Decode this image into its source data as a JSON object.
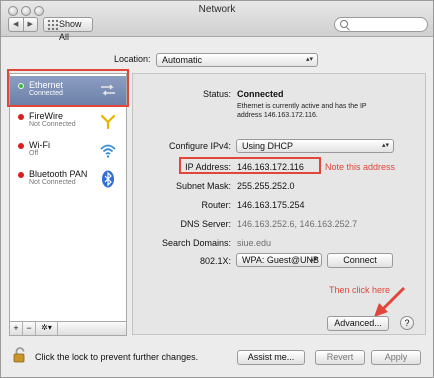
{
  "window": {
    "title": "Network"
  },
  "toolbar": {
    "back": "◀",
    "forward": "▶",
    "show_all": "Show All",
    "search_placeholder": ""
  },
  "location": {
    "label": "Location:",
    "value": "Automatic"
  },
  "services": [
    {
      "name": "Ethernet",
      "status": "Connected",
      "status_color": "#3dbb3d",
      "icon": "ethernet-arrows-icon",
      "selected": true
    },
    {
      "name": "FireWire",
      "status": "Not Connected",
      "status_color": "#d81f1f",
      "icon": "firewire-icon"
    },
    {
      "name": "Wi-Fi",
      "status": "Off",
      "status_color": "#d81f1f",
      "icon": "wifi-icon"
    },
    {
      "name": "Bluetooth PAN",
      "status": "Not Connected",
      "status_color": "#d81f1f",
      "icon": "bluetooth-icon"
    }
  ],
  "sidebar_buttons": {
    "add": "+",
    "remove": "−",
    "action": "✲▾"
  },
  "details": {
    "status_label": "Status:",
    "status_value": "Connected",
    "status_desc": "Ethernet is currently active and has the IP address 146.163.172.116.",
    "configure_label": "Configure IPv4:",
    "configure_value": "Using DHCP",
    "ip_label": "IP Address:",
    "ip_value": "146.163.172.116",
    "subnet_label": "Subnet Mask:",
    "subnet_value": "255.255.252.0",
    "router_label": "Router:",
    "router_value": "146.163.175.254",
    "dns_label": "DNS Server:",
    "dns_value": "146.163.252.6, 146.163.252.7",
    "search_domains_label": "Search Domains:",
    "search_domains_value": "siue.edu",
    "dot1x_label": "802.1X:",
    "dot1x_value": "WPA: Guest@UNB",
    "connect_label": "Connect",
    "advanced_label": "Advanced...",
    "help_label": "?"
  },
  "annotations": {
    "note_ip": "Note this address",
    "note_click": "Then click here",
    "color": "#e0463a"
  },
  "footer": {
    "lock_text": "Click the lock to prevent further changes.",
    "assist": "Assist me...",
    "revert": "Revert",
    "apply": "Apply"
  }
}
